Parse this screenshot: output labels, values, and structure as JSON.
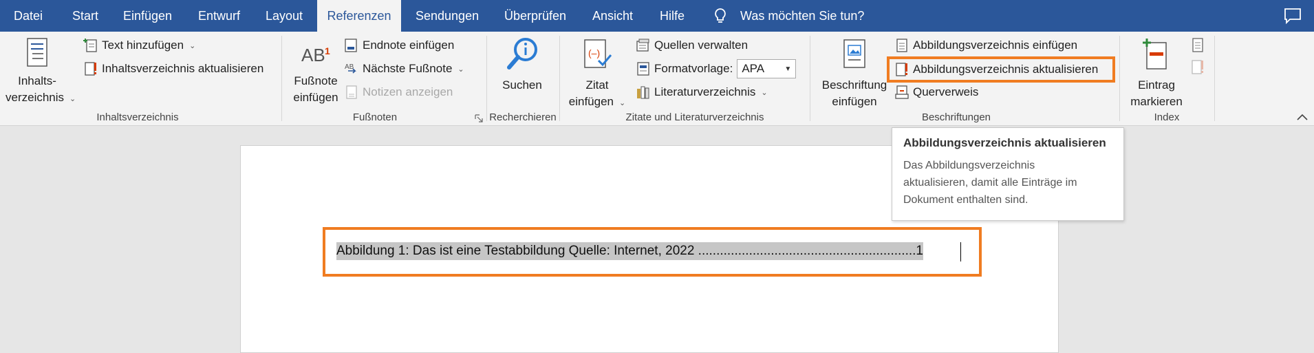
{
  "tabs": [
    {
      "label": "Datei"
    },
    {
      "label": "Start"
    },
    {
      "label": "Einfügen"
    },
    {
      "label": "Entwurf"
    },
    {
      "label": "Layout"
    },
    {
      "label": "Referenzen"
    },
    {
      "label": "Sendungen"
    },
    {
      "label": "Überprüfen"
    },
    {
      "label": "Ansicht"
    },
    {
      "label": "Hilfe"
    }
  ],
  "tell_me": "Was möchten Sie tun?",
  "colors": {
    "tabbar": "#2b579a",
    "highlight": "#f07c21",
    "ribbon": "#f3f3f3"
  },
  "toc": {
    "big_line1": "Inhalts-",
    "big_line2": "verzeichnis",
    "add_text": "Text hinzufügen",
    "update": "Inhaltsverzeichnis aktualisieren",
    "group": "Inhaltsverzeichnis"
  },
  "footnotes": {
    "big_line1": "Fußnote",
    "big_line2": "einfügen",
    "ab": "AB",
    "sup": "1",
    "endnote": "Endnote einfügen",
    "next": "Nächste Fußnote",
    "show_notes": "Notizen anzeigen",
    "group": "Fußnoten"
  },
  "research": {
    "search": "Suchen",
    "group": "Recherchieren"
  },
  "citations": {
    "big_line1": "Zitat",
    "big_line2": "einfügen",
    "manage": "Quellen verwalten",
    "style_label": "Formatvorlage:",
    "style_value": "APA",
    "bibliography": "Literaturverzeichnis",
    "group": "Zitate und Literaturverzeichnis"
  },
  "captions": {
    "big_line1": "Beschriftung",
    "big_line2": "einfügen",
    "insert_tof": "Abbildungsverzeichnis einfügen",
    "update_tof": "Abbildungsverzeichnis aktualisieren",
    "crossref": "Querverweis",
    "group": "Beschriftungen"
  },
  "index": {
    "big_line1": "Eintrag",
    "big_line2": "markieren",
    "group": "Index"
  },
  "tooltip": {
    "title": "Abbildungsverzeichnis aktualisieren",
    "lines": [
      "Das Abbildungsverzeichnis",
      "aktualisieren, damit alle Einträge im",
      "Dokument enthalten sind."
    ]
  },
  "document": {
    "entry": "Abbildung 1: Das ist eine Testabbildung Quelle: Internet, 2022 ............................................................1"
  }
}
